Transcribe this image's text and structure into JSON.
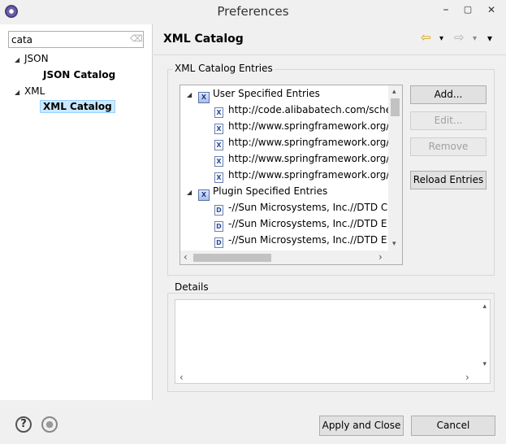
{
  "window": {
    "title": "Preferences",
    "minimize": "–",
    "maximize": "▢",
    "close": "✕"
  },
  "sidebar": {
    "filter_value": "cata",
    "tree": [
      {
        "label": "JSON",
        "arrow": "◢"
      },
      {
        "label": "JSON Catalog"
      },
      {
        "label": "XML",
        "arrow": "◢"
      },
      {
        "label": "XML Catalog"
      }
    ]
  },
  "page": {
    "title": "XML Catalog",
    "back": "⇦",
    "dropdown": "▾",
    "forward": "⇨",
    "menu": "▾"
  },
  "entries_group": {
    "label": "XML Catalog Entries",
    "user_group": "User Specified Entries",
    "user_entries": [
      "http://code.alibabatech.com/sche",
      "http://www.springframework.org/",
      "http://www.springframework.org/",
      "http://www.springframework.org/",
      "http://www.springframework.org/"
    ],
    "plugin_group": "Plugin Specified Entries",
    "plugin_entries": [
      "-//Sun Microsystems, Inc.//DTD C",
      "-//Sun Microsystems, Inc.//DTD E",
      "-//Sun Microsystems, Inc.//DTD E"
    ],
    "file_icon_letter": "X",
    "dtd_icon_letter": "D",
    "group_icon_letter": "X"
  },
  "buttons": {
    "add": "Add...",
    "edit": "Edit...",
    "remove": "Remove",
    "reload": "Reload Entries",
    "apply_close": "Apply and Close",
    "cancel": "Cancel"
  },
  "details": {
    "label": "Details"
  },
  "footer": {
    "help_icon": "?",
    "record_icon": "●"
  },
  "scroll_arrows": {
    "up": "▴",
    "down": "▾",
    "left": "‹",
    "right": "›"
  }
}
